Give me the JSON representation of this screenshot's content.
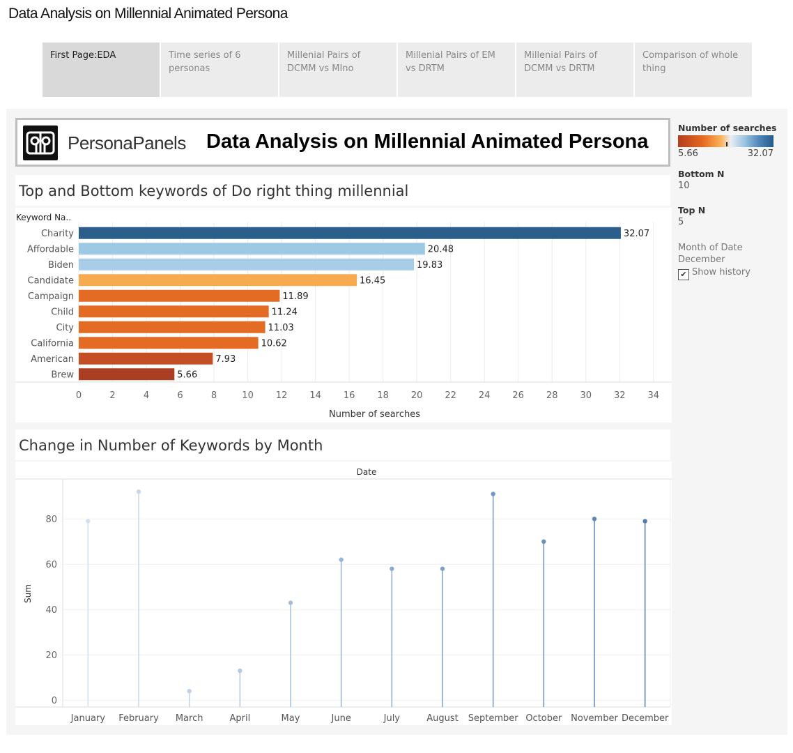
{
  "page_title": "Data Analysis on Millennial Animated Persona",
  "tabs": [
    {
      "label": "First Page:EDA",
      "active": true
    },
    {
      "label": "Time series of 6 personas",
      "active": false
    },
    {
      "label": "Millenial Pairs of DCMM vs MIno",
      "active": false
    },
    {
      "label": "Millenial Pairs of EM vs DRTM",
      "active": false
    },
    {
      "label": "Millenial Pairs of DCMM vs DRTM",
      "active": false
    },
    {
      "label": "Comparison of whole thing",
      "active": false
    }
  ],
  "banner": {
    "logo_text": "PersonaPanels",
    "title": "Data Analysis on Millennial Animated Persona"
  },
  "right_panel": {
    "legend_title": "Number of searches",
    "legend_min": "5.66",
    "legend_max": "32.07",
    "bottom_n_label": "Bottom N",
    "bottom_n_value": "10",
    "top_n_label": "Top N",
    "top_n_value": "5",
    "month_label": "Month of Date",
    "month_value": "December",
    "show_history_label": "Show history",
    "show_history_checked": true
  },
  "colors": {
    "dark_blue": "#2c5e8c",
    "light_blue": "#9ec9e4",
    "light_orange": "#f8aa4f",
    "orange": "#e36b24",
    "dark_orange": "#c44f24",
    "darkest": "#a93e22"
  },
  "chart_data": [
    {
      "type": "bar",
      "orientation": "horizontal",
      "title": "Top and Bottom keywords of Do right thing millennial",
      "ylabel": "Keyword Na..",
      "xlabel": "Number of searches",
      "categories": [
        "Charity",
        "Affordable",
        "Biden",
        "Candidate",
        "Campaign",
        "Child",
        "City",
        "California",
        "American",
        "Brew"
      ],
      "values": [
        32.07,
        20.48,
        19.83,
        16.45,
        11.89,
        11.24,
        11.03,
        10.62,
        7.93,
        5.66
      ],
      "colors": [
        "#2c5e8c",
        "#9ec9e4",
        "#a8cde6",
        "#f8aa4f",
        "#e36b24",
        "#e36b24",
        "#e36b24",
        "#e36b24",
        "#c44f24",
        "#a93e22"
      ],
      "xlim": [
        0,
        35
      ],
      "xticks": [
        0,
        2,
        4,
        6,
        8,
        10,
        12,
        14,
        16,
        18,
        20,
        22,
        24,
        26,
        28,
        30,
        32,
        34
      ],
      "grid": true
    },
    {
      "type": "lollipop",
      "title": "Change in Number of Keywords  by Month",
      "column_header": "Date",
      "ylabel": "Sum",
      "categories": [
        "January",
        "February",
        "March",
        "April",
        "May",
        "June",
        "July",
        "August",
        "September",
        "October",
        "November",
        "December"
      ],
      "values": [
        79,
        92,
        4,
        13,
        43,
        62,
        58,
        58,
        91,
        70,
        80,
        79
      ],
      "colors": [
        "#d3e0ee",
        "#c8d8ea",
        "#bed1e6",
        "#b3c9e2",
        "#a5bfdc",
        "#97b4d6",
        "#8aabd1",
        "#7ea1cb",
        "#7398c5",
        "#6a90be",
        "#5f87b6",
        "#537dae"
      ],
      "ylim": [
        -3,
        97
      ],
      "yticks": [
        0,
        20,
        40,
        60,
        80
      ],
      "grid": true
    }
  ]
}
